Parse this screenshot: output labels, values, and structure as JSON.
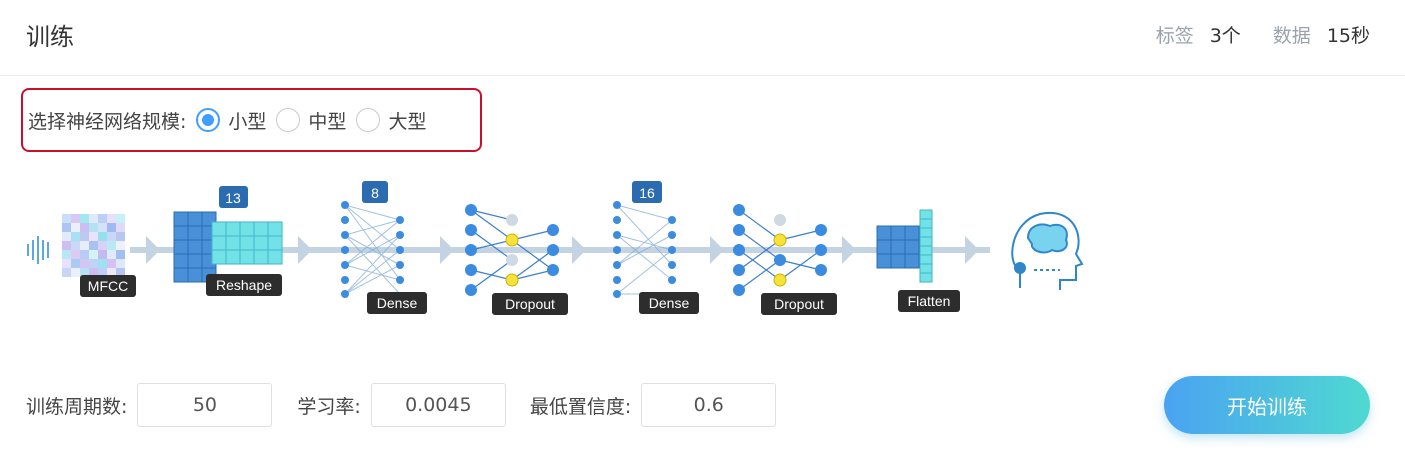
{
  "header": {
    "title": "训练",
    "label_tags": "标签",
    "value_tags": "3个",
    "label_data": "数据",
    "value_data": "15秒"
  },
  "model_size": {
    "label": "选择神经网络规模:",
    "options": [
      {
        "label": "小型",
        "selected": true
      },
      {
        "label": "中型",
        "selected": false
      },
      {
        "label": "大型",
        "selected": false
      }
    ]
  },
  "pipeline": {
    "stages": [
      {
        "name": "MFCC"
      },
      {
        "name": "Reshape",
        "units": "13"
      },
      {
        "name": "Dense",
        "units": "8"
      },
      {
        "name": "Dropout"
      },
      {
        "name": "Dense",
        "units": "16"
      },
      {
        "name": "Dropout"
      },
      {
        "name": "Flatten"
      }
    ]
  },
  "params": {
    "epochs_label": "训练周期数:",
    "epochs_value": "50",
    "lr_label": "学习率:",
    "lr_value": "0.0045",
    "confidence_label": "最低置信度:",
    "confidence_value": "0.6"
  },
  "start_button": "开始训练",
  "colors": {
    "accent": "#409eff",
    "highlight_border": "#c8102e",
    "button_gradient_start": "#4aa3f2",
    "button_gradient_end": "#4fd9d1"
  }
}
